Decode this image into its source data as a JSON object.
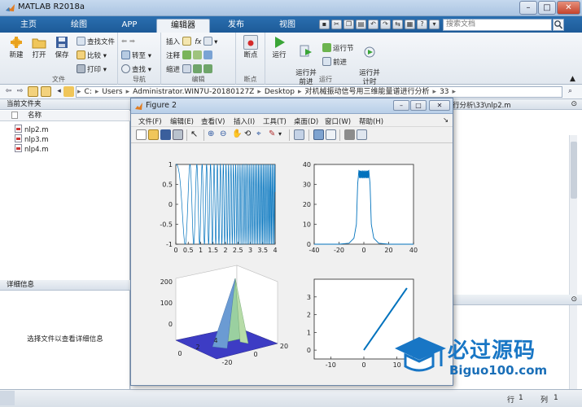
{
  "window": {
    "title": "MATLAB R2018a"
  },
  "tabs": [
    {
      "label": "主页"
    },
    {
      "label": "绘图"
    },
    {
      "label": "APP"
    },
    {
      "label": "编辑器"
    },
    {
      "label": "发布"
    },
    {
      "label": "视图"
    }
  ],
  "search": {
    "placeholder": "搜索文档"
  },
  "ribbon": {
    "file": {
      "label": "文件",
      "new": "新建",
      "open": "打开",
      "save": "保存",
      "find_files": "查找文件",
      "compare": "比较",
      "print": "打印"
    },
    "nav": {
      "label": "导航",
      "goto": "转至",
      "find": "查找"
    },
    "edit": {
      "label": "编辑",
      "insert": "插入",
      "comment": "注释",
      "indent": "缩进",
      "fx": "fx"
    },
    "breakpoints": {
      "label": "断点",
      "breakpoint": "断点"
    },
    "run": {
      "label": "运行",
      "run": "运行",
      "run_advance": "运行并\n前进",
      "run_section": "运行节",
      "advance": "前进",
      "run_time": "运行并\n计时"
    }
  },
  "address": {
    "segments": [
      "C:",
      "Users",
      "Administrator.WIN7U-20180127Z",
      "Desktop",
      "对机械振动信号用三维能量谱进行分析",
      "33"
    ]
  },
  "left_panel": {
    "header": "当前文件夹",
    "column": "名称",
    "files": [
      "nlp2.m",
      "nlp3.m",
      "nlp4.m"
    ],
    "detail_header": "详细信息",
    "detail_message": "选择文件以查看详细信息"
  },
  "editor": {
    "tab_text": "行分析\\33\\nlp2.m"
  },
  "status": {
    "line_label": "行",
    "line": "1",
    "col_label": "列",
    "col": "1"
  },
  "figure": {
    "title": "Figure 2",
    "menus": [
      "文件(F)",
      "编辑(E)",
      "查看(V)",
      "插入(I)",
      "工具(T)",
      "桌面(D)",
      "窗口(W)",
      "帮助(H)"
    ]
  },
  "chart_data": [
    {
      "type": "line",
      "title": "",
      "xlim": [
        0,
        4
      ],
      "ylim": [
        -1,
        1
      ],
      "xticks": [
        "0",
        "0.5",
        "1",
        "1.5",
        "2",
        "2.5",
        "3",
        "3.5",
        "4"
      ],
      "yticks": [
        "-1",
        "-0.5",
        "0",
        "0.5",
        "1"
      ],
      "description_color": "#0072bd",
      "series": [
        {
          "kind": "chirp",
          "amplitude": 1,
          "t_start": 0,
          "t_end": 4
        }
      ]
    },
    {
      "type": "line",
      "xlim": [
        -40,
        40
      ],
      "ylim": [
        0,
        40
      ],
      "xticks": [
        "-40",
        "-20",
        "0",
        "20",
        "40"
      ],
      "yticks": [
        "0",
        "10",
        "20",
        "30",
        "40"
      ],
      "series": [
        {
          "x": [
            -40,
            -20,
            -12,
            -8,
            -6,
            -5,
            -4,
            -2,
            0,
            2,
            4,
            5,
            6,
            8,
            12,
            20,
            40
          ],
          "y": [
            0,
            0,
            0.5,
            3,
            10,
            30,
            37,
            36,
            35,
            36,
            37,
            30,
            10,
            3,
            0.5,
            0,
            0
          ]
        }
      ]
    },
    {
      "type": "surface",
      "xticks": [
        "-20",
        "0",
        "20"
      ],
      "yticks": [
        "0",
        "2",
        "4"
      ],
      "zticks": [
        "0",
        "100",
        "200"
      ],
      "zlim": [
        0,
        250
      ]
    },
    {
      "type": "line",
      "xlim": [
        -15,
        15
      ],
      "ylim": [
        -0.5,
        4
      ],
      "xticks": [
        "-10",
        "0",
        "10"
      ],
      "yticks": [
        "0",
        "1",
        "2",
        "3"
      ],
      "series": [
        {
          "x": [
            0,
            13
          ],
          "y": [
            0,
            3.5
          ]
        }
      ]
    }
  ],
  "watermark": {
    "title": "必过源码",
    "subtitle": "Biguo100.com"
  },
  "colors": {
    "matlab_blue": "#0072bd",
    "tab_bar": "#1d5a98",
    "surface_low": "#3d3cc4",
    "surface_peak": "#9ad0a0"
  }
}
